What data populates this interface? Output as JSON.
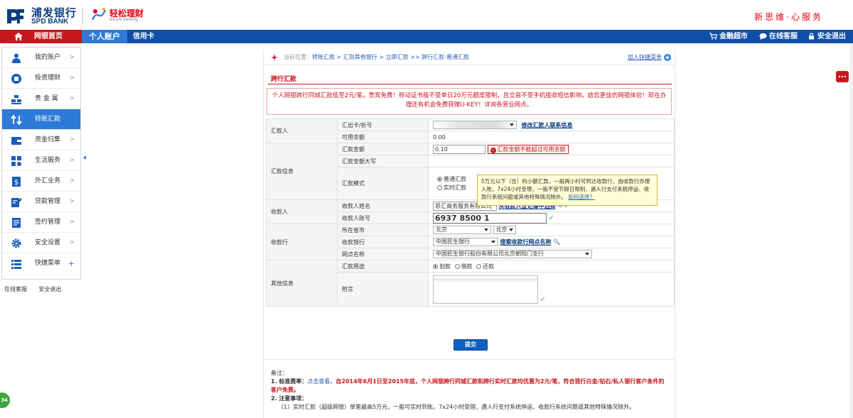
{
  "brand": {
    "cn": "浦发银行",
    "en": "SPD BANK",
    "sub_cn": "轻松理财",
    "sub_en": "leisure banking",
    "slogan": "新思维·心服务",
    "red": "#e60012",
    "blue": "#0b3d7e"
  },
  "nav": {
    "home": "网银首页",
    "personal": "个人账户",
    "credit": "信用卡",
    "market": "金融超市",
    "service": "在线客服",
    "logout": "安全退出",
    "bar_color": "#0f4fa8",
    "home_color": "#c9161d"
  },
  "sidebar": {
    "items": [
      {
        "label": "我的账户",
        "icon": "user-icon"
      },
      {
        "label": "投资理财",
        "icon": "invest-icon"
      },
      {
        "label": "贵 金 属",
        "icon": "gold-icon"
      },
      {
        "label": "转账汇款",
        "icon": "transfer-icon"
      },
      {
        "label": "资金归集",
        "icon": "fund-icon"
      },
      {
        "label": "生活服务",
        "icon": "life-icon"
      },
      {
        "label": "外汇业务",
        "icon": "forex-icon"
      },
      {
        "label": "贷款管理",
        "icon": "loan-icon"
      },
      {
        "label": "签约管理",
        "icon": "contract-icon"
      },
      {
        "label": "安全设置",
        "icon": "gear-icon"
      },
      {
        "label": "快捷菜单",
        "icon": "menu-icon"
      }
    ],
    "arrow": ">",
    "plus": "+",
    "footer_service": "在线客服",
    "footer_logout": "安全退出"
  },
  "breadcrumb": {
    "prefix": "当前位置：",
    "path": "转账汇款 > 汇到其他银行 > 立即汇款 >> ",
    "current": "跨行汇款-普通汇款",
    "shortcut": "加入快捷菜单"
  },
  "section_title": "跨行汇款",
  "notice": "个人网银跨行同城汇款低至2元/笔，贵宾免费！移动证书版不受单日20万元额度限制，且交易不受手机接收短信影响，给您更佳的网银体验！现在办理还有机会免费获赠U-KEY！详询各营业网点。",
  "form": {
    "remitter": {
      "group": "汇款人",
      "card_label": "汇出卡/折号",
      "modify_link": "修改汇款人联系信息",
      "balance_label": "可用余额",
      "balance": "0.00"
    },
    "remit_info": {
      "group": "汇款信息",
      "amount_label": "汇款金额",
      "amount": "0.10",
      "amount_error": "汇款金额不能超过可用余额",
      "upper_label": "汇款金额大写",
      "mode_label": "汇款模式",
      "mode_normal": "普通汇款",
      "mode_realtime": "实时汇款"
    },
    "payee": {
      "group": "收款人",
      "name_label": "收款人姓名",
      "name": "思汇商务服务有限公司",
      "name_link": "从收款人登记簿中选择",
      "account_label": "收款人账号",
      "account": "6937 8500 1"
    },
    "bank": {
      "group": "收款行",
      "region_label": "所在省市",
      "province": "北京",
      "city": "北京",
      "bank_label": "收款银行",
      "bank": "中国民生银行",
      "search_link": "搜索收款行网点名称",
      "branch_label": "网点名称",
      "branch": "中国民生银行股份有限公司北京朝阳门支行"
    },
    "other": {
      "group": "其他信息",
      "purpose_label": "汇款用途",
      "purpose_1": "划款",
      "purpose_2": "借款",
      "purpose_3": "还款",
      "remark_label": "附言"
    }
  },
  "tooltip": {
    "text": "5万元以下（含）的小额汇款，一般两小时可到达收款行，由收款行办理入账。7x24小时受理，一般不受节假日限制，遇人行支付系统停运、收款行系统问题或其他特殊情况除外。",
    "link": "如何选择？"
  },
  "submit": "提交",
  "notes": {
    "title": "备注：",
    "item1_label": "1. 标准费率：",
    "item1_link": "点击查看。",
    "item1_text": "自2014年6月1日至2015年底，个人网银跨行同城汇款和跨行实时汇款均优惠为2元/笔，符合我行白金/钻石/私人银行客户条件的客户免费。",
    "item2_label": "2. 注意事项：",
    "item2_text": "（1）实时汇款（超级网银）单笔最高5万元，一般可实时到账。7x24小时受理，遇人行支付系统停运、收款行系统问题或其他特殊情况除外。"
  },
  "float_ball": "34"
}
